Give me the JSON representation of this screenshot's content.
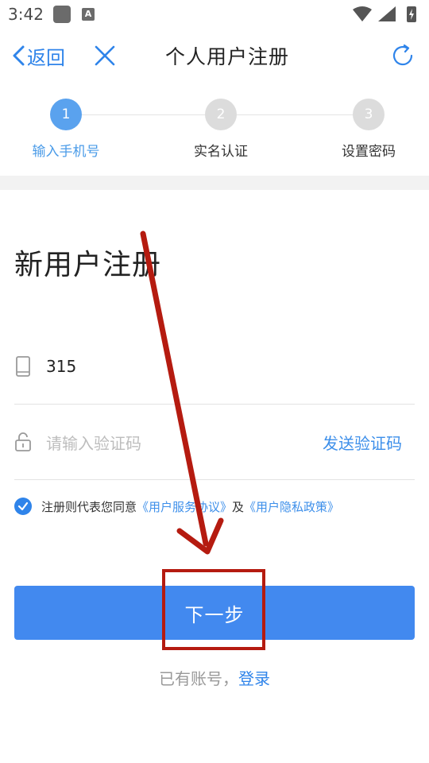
{
  "status_bar": {
    "time": "3:42",
    "notification_icon": "notification-square-icon",
    "app_icon_letter": "A",
    "icons": [
      "wifi-icon",
      "signal-icon",
      "battery-charging-icon"
    ]
  },
  "topbar": {
    "back_label": "返回",
    "title": "个人用户注册",
    "close_icon": "close-icon",
    "refresh_icon": "refresh-icon"
  },
  "steps": [
    {
      "number": "1",
      "label": "输入手机号",
      "active": true
    },
    {
      "number": "2",
      "label": "实名认证",
      "active": false
    },
    {
      "number": "3",
      "label": "设置密码",
      "active": false
    }
  ],
  "form": {
    "heading": "新用户注册",
    "phone_value": "315",
    "code_placeholder": "请输入验证码",
    "send_code_label": "发送验证码"
  },
  "agreement": {
    "checked": true,
    "prefix": "注册则代表您同意",
    "service_link": "《用户服务协议》",
    "conjunction": "及",
    "privacy_link": "《用户隐私政策》"
  },
  "next_button_label": "下一步",
  "login": {
    "prompt": "已有账号，",
    "link": "登录"
  },
  "colors": {
    "accent": "#2f84ea",
    "button": "#4289ef",
    "step_active": "#5aa2ee",
    "annotation": "#b51b10"
  }
}
